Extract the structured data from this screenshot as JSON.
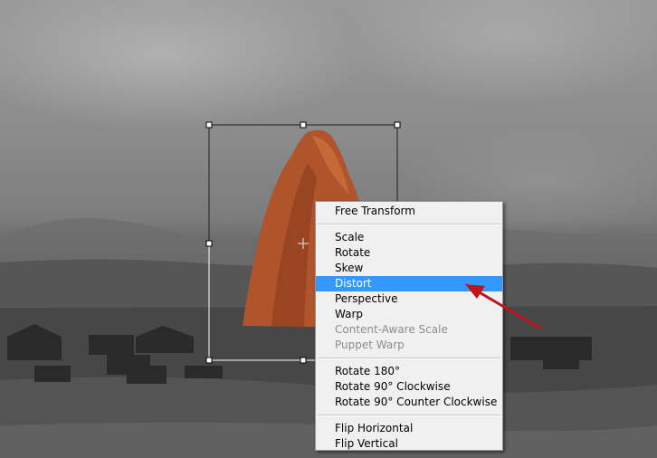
{
  "context_menu": {
    "groups": [
      [
        {
          "label": "Free Transform",
          "enabled": true
        }
      ],
      [
        {
          "label": "Scale",
          "enabled": true
        },
        {
          "label": "Rotate",
          "enabled": true
        },
        {
          "label": "Skew",
          "enabled": true
        },
        {
          "label": "Distort",
          "enabled": true,
          "highlighted": true
        },
        {
          "label": "Perspective",
          "enabled": true
        },
        {
          "label": "Warp",
          "enabled": true
        },
        {
          "label": "Content-Aware Scale",
          "enabled": false
        },
        {
          "label": "Puppet Warp",
          "enabled": false
        }
      ],
      [
        {
          "label": "Rotate 180°",
          "enabled": true
        },
        {
          "label": "Rotate 90° Clockwise",
          "enabled": true
        },
        {
          "label": "Rotate 90° Counter Clockwise",
          "enabled": true
        }
      ],
      [
        {
          "label": "Flip Horizontal",
          "enabled": true
        },
        {
          "label": "Flip Vertical",
          "enabled": true
        }
      ]
    ]
  },
  "colors": {
    "menu_highlight": "#3399ff",
    "annotation_arrow": "#c0141c",
    "rock": "#b0542b"
  }
}
